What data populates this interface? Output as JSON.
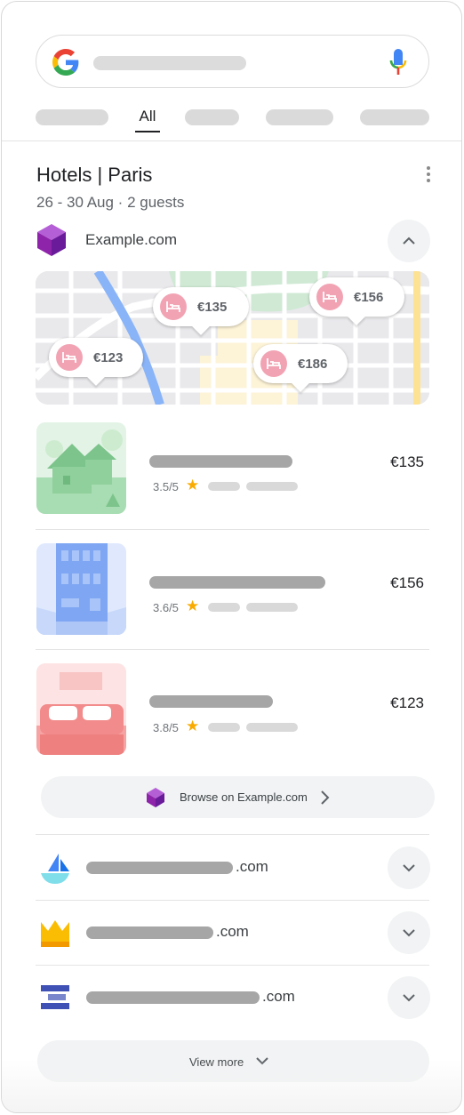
{
  "search": {
    "tabs": {
      "active_label": "All"
    }
  },
  "hotel_card": {
    "title": "Hotels | Paris",
    "subtitle": "26 - 30 Aug · 2 guests",
    "provider": {
      "name": "Example.com",
      "logo_icon": "purple-cube-icon"
    },
    "map_pins": [
      {
        "price": "€135"
      },
      {
        "price": "€156"
      },
      {
        "price": "€123"
      },
      {
        "price": "€186"
      }
    ],
    "results": [
      {
        "rating": "3.5/5",
        "price": "€135",
        "image": "house-illustration"
      },
      {
        "rating": "3.6/5",
        "price": "€156",
        "image": "building-illustration"
      },
      {
        "rating": "3.8/5",
        "price": "€123",
        "image": "bed-illustration"
      }
    ],
    "browse_button": "Browse on Example.com"
  },
  "other_providers": [
    {
      "tld": ".com",
      "logo_icon": "sailboat-logo-icon"
    },
    {
      "tld": ".com",
      "logo_icon": "crown-logo-icon"
    },
    {
      "tld": ".com",
      "logo_icon": "stacked-bars-logo-icon"
    }
  ],
  "view_more_label": "View more",
  "colors": {
    "star": "#f9ab00",
    "pin_accent": "#f2a3b3",
    "provider_purple": "#8e24aa"
  }
}
